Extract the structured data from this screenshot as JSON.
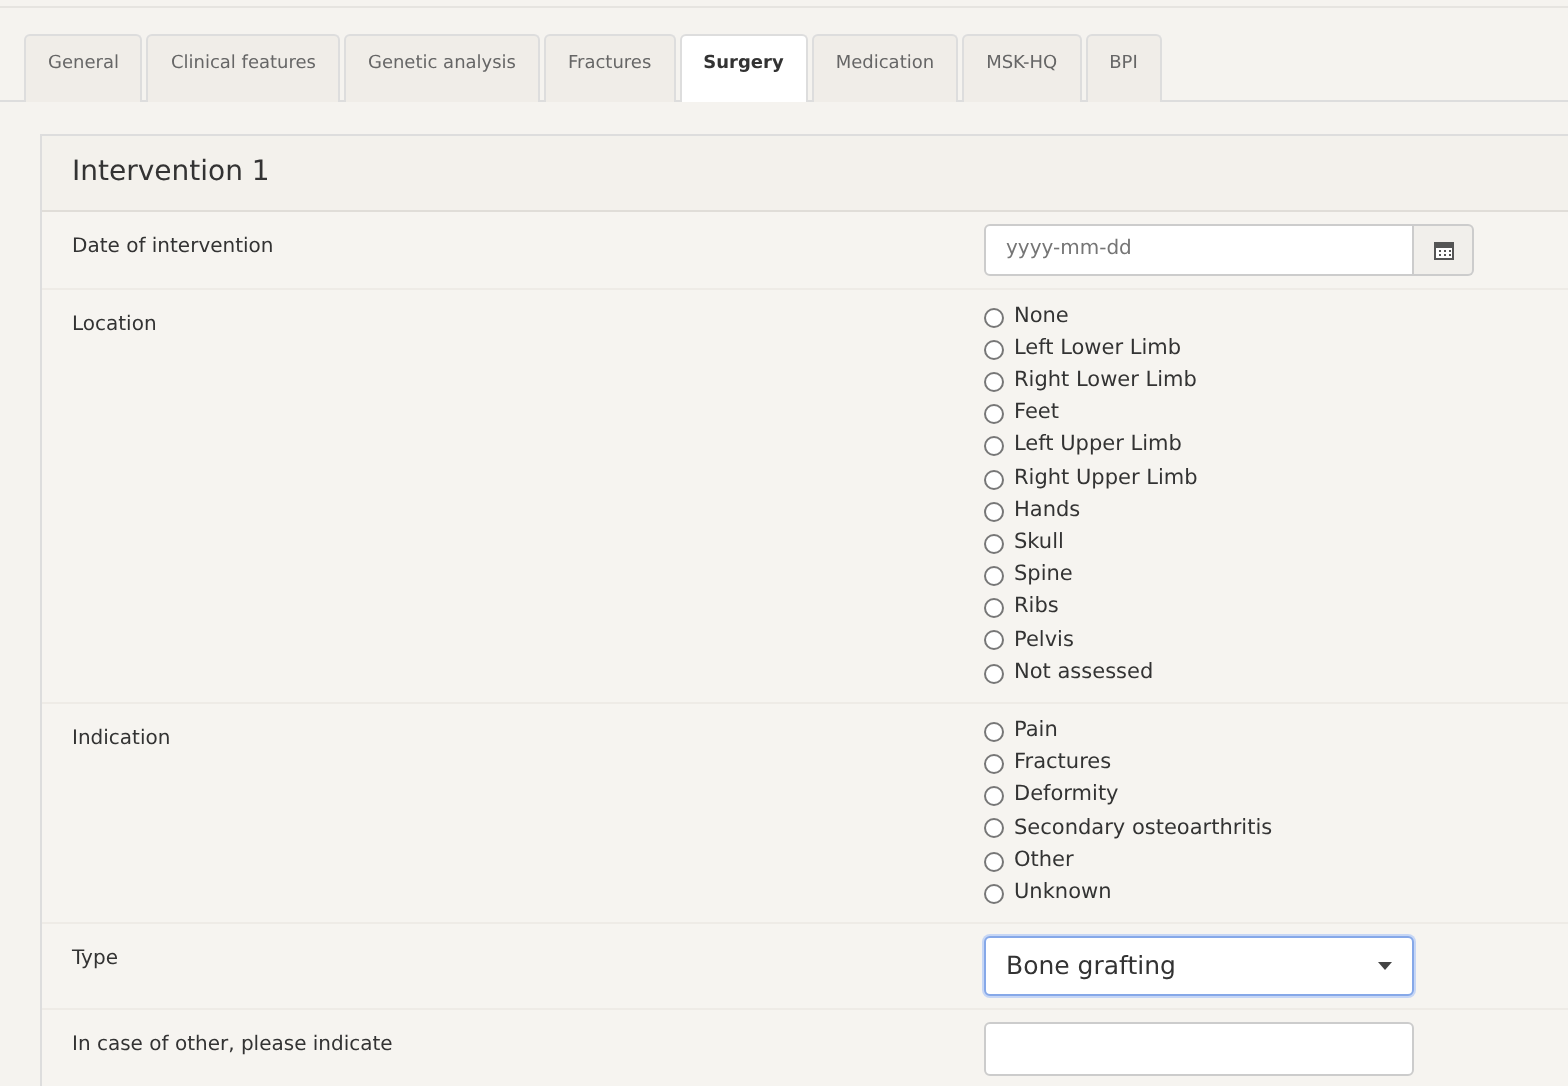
{
  "tabs": [
    {
      "label": "General",
      "selected": false
    },
    {
      "label": "Clinical features",
      "selected": false
    },
    {
      "label": "Genetic analysis",
      "selected": false
    },
    {
      "label": "Fractures",
      "selected": false
    },
    {
      "label": "Surgery",
      "selected": true
    },
    {
      "label": "Medication",
      "selected": false
    },
    {
      "label": "MSK-HQ",
      "selected": false
    },
    {
      "label": "BPI",
      "selected": false
    }
  ],
  "panel": {
    "title": "Intervention 1",
    "fields": [
      {
        "kind": "date",
        "label": "Date of intervention",
        "placeholder": "yyyy-mm-dd"
      },
      {
        "kind": "radio",
        "label": "Location",
        "options": [
          {
            "label": "None",
            "selected": false
          },
          {
            "label": "Left Lower Limb",
            "selected": false
          },
          {
            "label": "Right Lower Limb",
            "selected": false
          },
          {
            "label": "Feet",
            "selected": false
          },
          {
            "label": "Left Upper Limb",
            "selected": false
          },
          {
            "label": "Right Upper Limb",
            "selected": false
          },
          {
            "label": "Hands",
            "selected": false
          },
          {
            "label": "Skull",
            "selected": false
          },
          {
            "label": "Spine",
            "selected": false
          },
          {
            "label": "Ribs",
            "selected": false
          },
          {
            "label": "Pelvis",
            "selected": false
          },
          {
            "label": "Not assessed",
            "selected": false
          }
        ]
      },
      {
        "kind": "radio",
        "label": "Indication",
        "options": [
          {
            "label": "Pain",
            "selected": false
          },
          {
            "label": "Fractures",
            "selected": false
          },
          {
            "label": "Deformity",
            "selected": false
          },
          {
            "label": "Secondary osteoarthritis",
            "selected": false
          },
          {
            "label": "Other",
            "selected": false
          },
          {
            "label": "Unknown",
            "selected": false
          }
        ]
      },
      {
        "kind": "select",
        "label": "Type",
        "value": "Bone grafting",
        "focused": true
      },
      {
        "kind": "text",
        "label": "In case of other, please indicate"
      }
    ]
  }
}
